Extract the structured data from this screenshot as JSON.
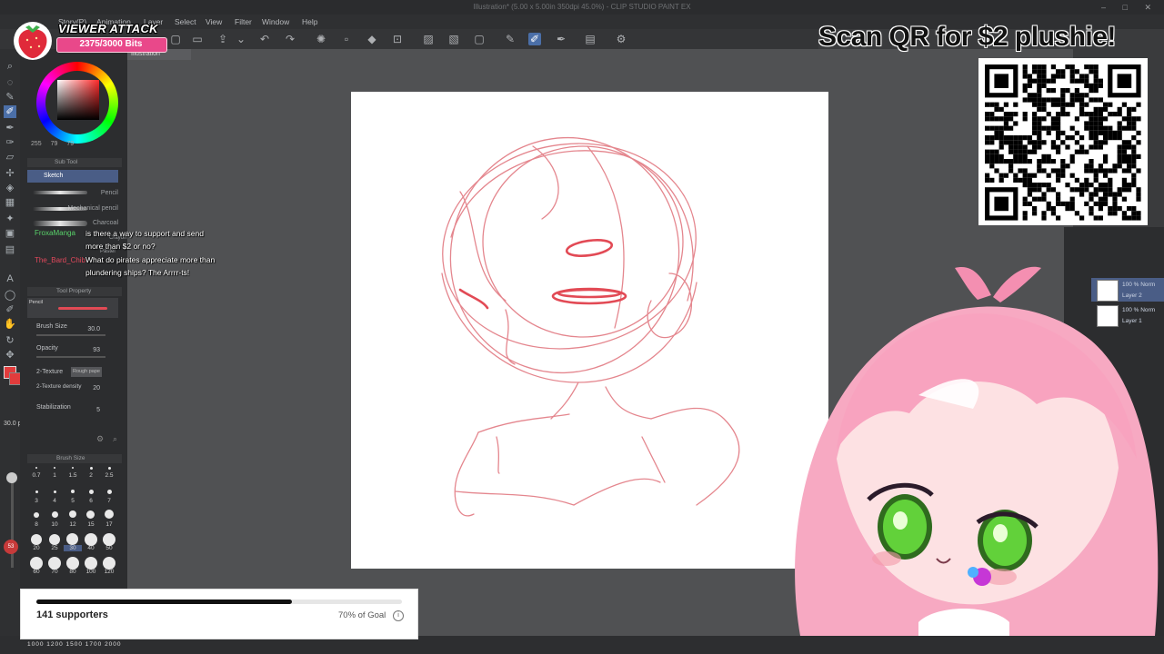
{
  "window": {
    "title": "Illustration* (5.00 x 5.00in 350dpi 45.0%) - CLIP STUDIO PAINT EX"
  },
  "menu": [
    "Story(P)",
    "Animation",
    "Layer",
    "Select",
    "View",
    "Filter",
    "Window",
    "Help"
  ],
  "document_tab": "Illustration",
  "color": {
    "current": "#e23c3c",
    "r": "255",
    "g": "79",
    "b": "79"
  },
  "sub_tool": {
    "header": "Sub Tool",
    "group": "Sketch",
    "items": [
      "Pencil",
      "Mechanical pencil",
      "Charcoal",
      "Crayon",
      "Pastel"
    ]
  },
  "tool_property": {
    "header": "Tool Property",
    "tool_name": "Pencil",
    "brush_size_label": "Brush Size",
    "brush_size_value": "30.0",
    "opacity_label": "Opacity",
    "opacity_value": "93",
    "texture_label": "2-Texture",
    "texture_value": "Rough pape",
    "texture_density_label": "2-Texture density",
    "texture_density_value": "20",
    "stabilization_label": "Stabilization",
    "stabilization_value": "5"
  },
  "brush_size_panel": {
    "header": "Brush Size",
    "sizes": [
      [
        "0.7",
        "1",
        "1.5",
        "2",
        "2.5"
      ],
      [
        "3",
        "4",
        "5",
        "6",
        "7"
      ],
      [
        "8",
        "10",
        "12",
        "15",
        "17"
      ],
      [
        "20",
        "25",
        "30",
        "40",
        "50"
      ],
      [
        "60",
        "70",
        "80",
        "100",
        "120"
      ]
    ],
    "bottom_scale": "1000 1200 1500 1700 2000"
  },
  "size_readout": "30.0 px",
  "red_indicator": "53",
  "layers": [
    {
      "name": "Layer 2",
      "blend": "100 % Norm"
    },
    {
      "name": "Layer 1",
      "blend": "100 % Norm"
    }
  ],
  "overlay": {
    "viewer_attack_title": "VIEWER ATTACK",
    "bits": "2375/3000 Bits",
    "qr_title": "Scan QR for $2 plushie!"
  },
  "chat": [
    {
      "user": "FroxaManga",
      "user_color": "#59d36a",
      "text": "is there a way to support and send more than $2 or no?"
    },
    {
      "user": "The_Bard_Chib",
      "user_color": "#e2485c",
      "text": "What do pirates appreciate more than plundering ships? The Arrrr-ts!"
    }
  ],
  "goal": {
    "supporters": "141 supporters",
    "percent_text": "70% of Goal",
    "progress": 0.7
  }
}
